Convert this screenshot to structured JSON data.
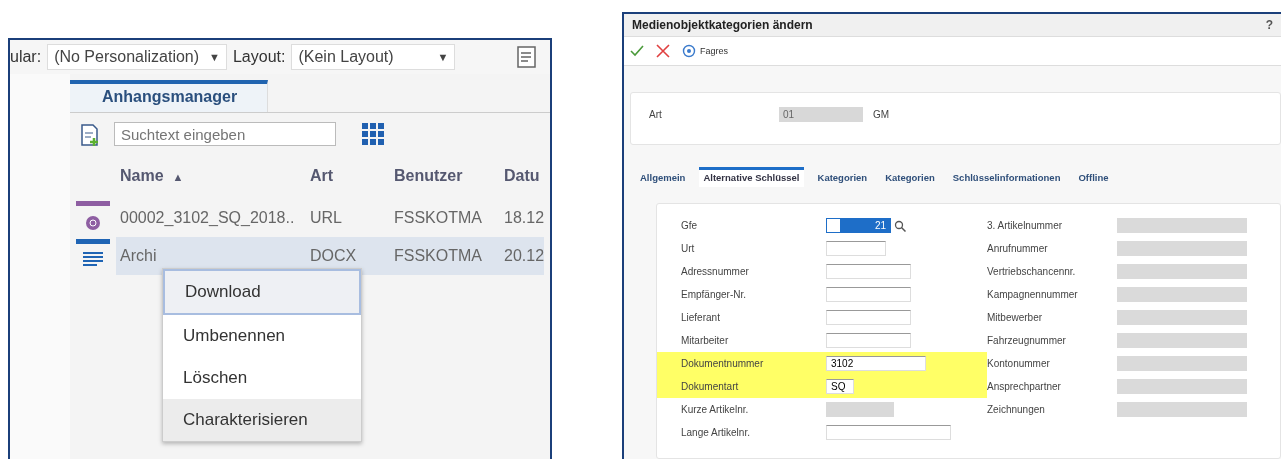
{
  "attachments_panel": {
    "toolbar": {
      "cut_label": "ular:",
      "personalization": {
        "value": "(No Personalization)",
        "caret": "▼"
      },
      "layout_label": "Layout:",
      "layout": {
        "value": "(Kein Layout)",
        "caret": "▼"
      }
    },
    "tab": {
      "label": "Anhangsmanager",
      "selected": true
    },
    "search": {
      "placeholder": "Suchtext eingeben"
    },
    "columns": [
      {
        "label": "Name",
        "sort": "▲"
      },
      {
        "label": "Art"
      },
      {
        "label": "Benutzer"
      },
      {
        "label": "Datu"
      }
    ],
    "rows": [
      {
        "kind": "url",
        "color": "#8e5ea2",
        "name": "00002_3102_SQ_2018..",
        "type": "URL",
        "user": "FSSKOTMA",
        "date": "18.12",
        "selected": false
      },
      {
        "kind": "document",
        "color": "#1f64b4",
        "name": "Archi",
        "type": "DOCX",
        "user": "FSSKOTMA",
        "date": "20.12",
        "selected": true
      }
    ],
    "context_menu": [
      {
        "label": "Download",
        "focused": true,
        "hovered": false
      },
      {
        "label": "Umbenennen",
        "focused": false,
        "hovered": false
      },
      {
        "label": "Löschen",
        "focused": false,
        "hovered": false
      },
      {
        "label": "Charakterisieren",
        "focused": false,
        "hovered": true
      }
    ]
  },
  "category_dialog": {
    "title": "Medienobjektkategorien ändern",
    "help": "?",
    "toolbar": {
      "action_label": "Fagres"
    },
    "header": {
      "label": "Art",
      "value": "01",
      "description": "GM"
    },
    "tabs": [
      {
        "label": "Allgemein",
        "selected": false
      },
      {
        "label": "Alternative Schlüssel",
        "selected": true
      },
      {
        "label": "Kategorien",
        "selected": false
      },
      {
        "label": "Kategorien",
        "selected": false
      },
      {
        "label": "Schlüsselinformationen",
        "selected": false
      },
      {
        "label": "Offline",
        "selected": false
      }
    ],
    "left_fields": [
      {
        "label": "Gfe",
        "value": "21",
        "kind": "search",
        "highlighted": false
      },
      {
        "label": "Urt",
        "kind": "short",
        "highlighted": false
      },
      {
        "label": "Adressnummer",
        "kind": "medium",
        "highlighted": false
      },
      {
        "label": "Empfänger-Nr.",
        "kind": "medium",
        "highlighted": false
      },
      {
        "label": "Lieferant",
        "kind": "medium",
        "highlighted": false
      },
      {
        "label": "Mitarbeiter",
        "kind": "medium",
        "highlighted": false
      },
      {
        "label": "Dokumentnummer",
        "value": "3102",
        "kind": "long",
        "highlighted": true
      },
      {
        "label": "Dokumentart",
        "value": "SQ",
        "kind": "tiny",
        "highlighted": true
      },
      {
        "label": "Kurze Artikelnr.",
        "kind": "readonly",
        "highlighted": false
      },
      {
        "label": "Lange Artikelnr.",
        "kind": "wide",
        "highlighted": false
      }
    ],
    "right_fields": [
      {
        "label": "3. Artikelnummer"
      },
      {
        "label": "Anrufnummer"
      },
      {
        "label": "Vertriebschancennr."
      },
      {
        "label": "Kampagnennummer"
      },
      {
        "label": "Mitbewerber"
      },
      {
        "label": "Fahrzeugnummer"
      },
      {
        "label": "Kontonummer"
      },
      {
        "label": "Ansprechpartner"
      },
      {
        "label": "Zeichnungen"
      }
    ]
  }
}
